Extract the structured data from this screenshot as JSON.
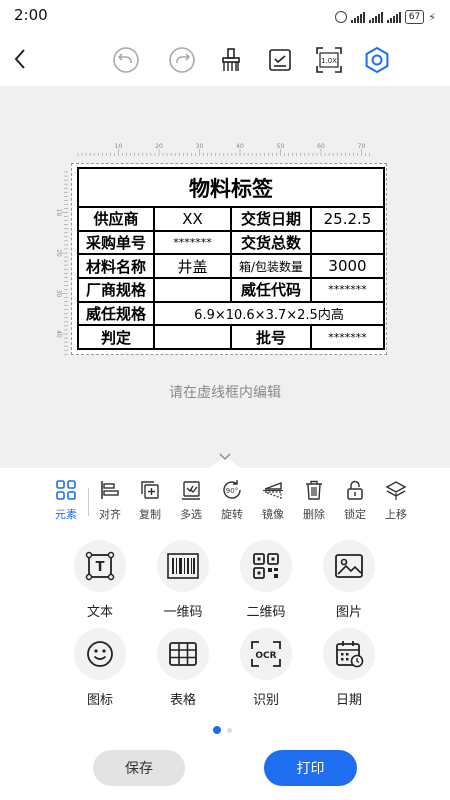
{
  "status_bar": {
    "time": "2:00",
    "battery": "67",
    "icons": [
      "alarm-icon",
      "signal-icon",
      "signal-icon",
      "signal-icon",
      "battery-icon",
      "charging-icon"
    ]
  },
  "toolbar": {
    "icons": [
      "back-icon",
      "undo-icon",
      "redo-icon",
      "clear-icon",
      "checklist-icon",
      "zoom-icon",
      "settings-icon"
    ],
    "zoom_label": "1.0X"
  },
  "ruler": {
    "top_ticks": [
      "10",
      "20",
      "30",
      "40",
      "50",
      "60",
      "70"
    ],
    "left_ticks": [
      "10",
      "20",
      "30",
      "40"
    ]
  },
  "label": {
    "title": "物料标签",
    "rows": [
      [
        "供应商",
        "XX",
        "交货日期",
        "25.2.5"
      ],
      [
        "采购单号",
        "*******",
        "交货总数",
        ""
      ],
      [
        "材料名称",
        "井盖",
        "箱/包装数量",
        "3000"
      ],
      [
        "厂商规格",
        "",
        "威任代码",
        "*******"
      ]
    ],
    "spec_label": "威任规格",
    "spec_value": "6.9×10.6×3.7×2.5内高",
    "judge_label": "判定",
    "judge_value": "",
    "batch_label": "批号",
    "batch_value": "*******"
  },
  "hint": "请在虚线框内编辑",
  "tools": [
    {
      "label": "元素",
      "icon": "elements-icon",
      "active": true
    },
    {
      "label": "对齐",
      "icon": "align-icon"
    },
    {
      "label": "复制",
      "icon": "copy-icon"
    },
    {
      "label": "多选",
      "icon": "multi-select-icon"
    },
    {
      "label": "旋转",
      "icon": "rotate-icon"
    },
    {
      "label": "镜像",
      "icon": "mirror-icon"
    },
    {
      "label": "删除",
      "icon": "delete-icon"
    },
    {
      "label": "锁定",
      "icon": "lock-icon"
    },
    {
      "label": "上移",
      "icon": "move-up-icon"
    }
  ],
  "rotate_badge": "90°",
  "elements": [
    {
      "label": "文本",
      "icon": "text-icon"
    },
    {
      "label": "一维码",
      "icon": "barcode-icon"
    },
    {
      "label": "二维码",
      "icon": "qrcode-icon"
    },
    {
      "label": "图片",
      "icon": "image-icon"
    },
    {
      "label": "图标",
      "icon": "emoji-icon"
    },
    {
      "label": "表格",
      "icon": "table-icon"
    },
    {
      "label": "识别",
      "icon": "ocr-icon"
    },
    {
      "label": "日期",
      "icon": "date-icon"
    }
  ],
  "ocr_text": "OCR",
  "text_glyph": "T",
  "pager": {
    "current": 1,
    "total": 2
  },
  "buttons": {
    "save": "保存",
    "print": "打印"
  },
  "colors": {
    "accent": "#1f6ef0",
    "canvas_bg": "#f0f0f0"
  }
}
